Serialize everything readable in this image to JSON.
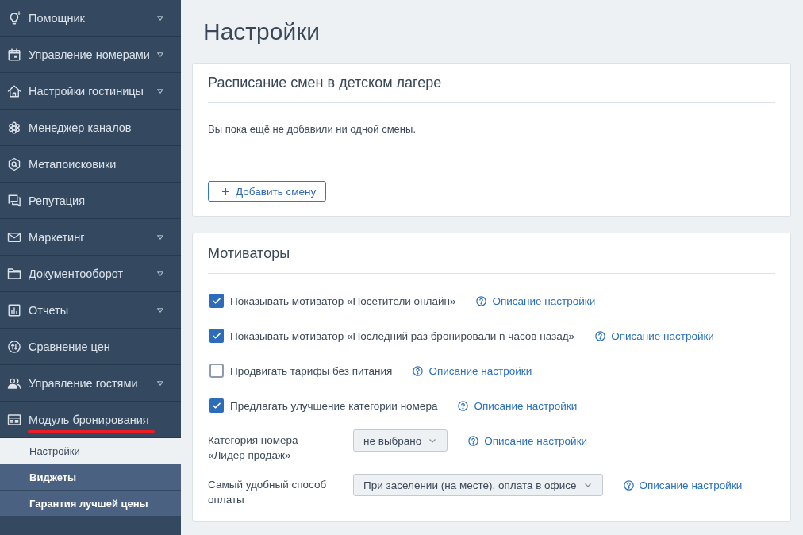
{
  "sidebar": {
    "items": [
      {
        "label": "Помощник",
        "expandable": true,
        "selected": false
      },
      {
        "label": "Управление номерами",
        "expandable": true,
        "selected": false
      },
      {
        "label": "Настройки гостиницы",
        "expandable": true,
        "selected": false
      },
      {
        "label": "Менеджер каналов",
        "expandable": false,
        "selected": false
      },
      {
        "label": "Метапоисковики",
        "expandable": false,
        "selected": false
      },
      {
        "label": "Репутация",
        "expandable": false,
        "selected": false
      },
      {
        "label": "Маркетинг",
        "expandable": true,
        "selected": false
      },
      {
        "label": "Документооборот",
        "expandable": true,
        "selected": false
      },
      {
        "label": "Отчеты",
        "expandable": true,
        "selected": false
      },
      {
        "label": "Сравнение цен",
        "expandable": false,
        "selected": false
      },
      {
        "label": "Управление гостями",
        "expandable": true,
        "selected": false
      },
      {
        "label": "Модуль бронирования",
        "expandable": false,
        "selected": true,
        "children": [
          {
            "label": "Настройки",
            "selected": true
          },
          {
            "label": "Виджеты",
            "selected": false
          },
          {
            "label": "Гарантия лучшей цены",
            "selected": false
          }
        ]
      }
    ]
  },
  "page_title": "Настройки",
  "schedule_card": {
    "title": "Расписание смен в детском лагере",
    "empty_text": "Вы пока ещё не добавили ни одной смены.",
    "add_button": "Добавить смену"
  },
  "motivators_card": {
    "title": "Мотиваторы",
    "settings": [
      {
        "kind": "checkbox",
        "label": "Показывать мотиватор «Посетители онлайн»",
        "checked": true,
        "help_link": "Описание настройки"
      },
      {
        "kind": "checkbox",
        "label": "Показывать мотиватор «Последний раз бронировали n часов назад»",
        "checked": true,
        "help_link": "Описание настройки"
      },
      {
        "kind": "checkbox",
        "label": "Продвигать тарифы без питания",
        "checked": false,
        "help_link": "Описание настройки"
      },
      {
        "kind": "checkbox",
        "label": "Предлагать улучшение категории номера",
        "checked": true,
        "help_link": "Описание настройки"
      },
      {
        "kind": "select",
        "label": "Категория номера «Лидер продаж»",
        "value": "не выбрано",
        "help_link": "Описание настройки"
      },
      {
        "kind": "select",
        "label": "Самый удобный способ оплаты",
        "value": "При заселении (на месте), оплата в офисе",
        "help_link": "Описание настройки"
      }
    ]
  }
}
